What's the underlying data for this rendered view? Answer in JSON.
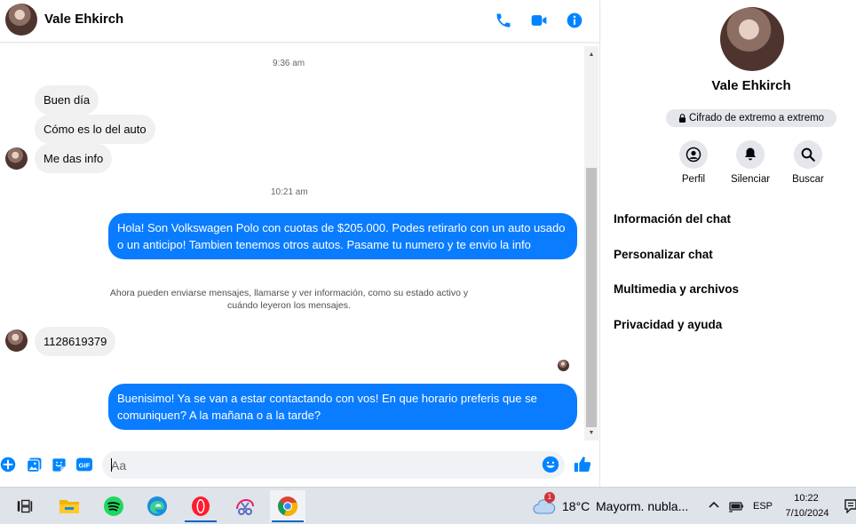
{
  "contact": {
    "name": "Vale Ehkirch"
  },
  "colors": {
    "accent": "#0084ff",
    "bubble_out": "#0a7cff",
    "bubble_in": "#f0f0f0"
  },
  "header_icons": [
    "phone-icon",
    "video-camera-icon",
    "info-icon"
  ],
  "messages": {
    "ts1": "9:36 am",
    "in1": "Buen día",
    "in2": "Cómo es lo del auto",
    "in3": "Me das info",
    "ts2": "10:21 am",
    "out1": "Hola! Son Volkswagen Polo con cuotas de $205.000. Podes retirarlo con un auto usado o un anticipo! Tambien tenemos otros autos. Pasame tu numero y te envio la info",
    "system_note": "Ahora pueden enviarse mensajes, llamarse y ver información, como su estado activo y cuándo leyeron los mensajes.",
    "in4": "1128619379",
    "out2": "Buenisimo! Ya se van a estar contactando con vos! En que horario preferis que se comuniquen? A la mañana o a la tarde?"
  },
  "composer": {
    "placeholder": "Aa",
    "value": ""
  },
  "info_panel": {
    "name": "Vale Ehkirch",
    "e2e_badge": "Cifrado de extremo a extremo",
    "actions": [
      {
        "label": "Perfil",
        "icon": "user-circle-icon"
      },
      {
        "label": "Silenciar",
        "icon": "bell-icon"
      },
      {
        "label": "Buscar",
        "icon": "search-icon"
      }
    ],
    "menu": [
      "Información del chat",
      "Personalizar chat",
      "Multimedia y archivos",
      "Privacidad y ayuda"
    ]
  },
  "taskbar": {
    "apps": [
      "task-view-icon",
      "file-explorer-icon",
      "spotify-icon",
      "edge-icon",
      "opera-icon",
      "snipping-tool-icon",
      "chrome-icon"
    ],
    "weather": {
      "temp": "18°C",
      "desc": "Mayorm. nubla...",
      "badge": "1"
    },
    "lang": "ESP",
    "time": "10:22",
    "date": "7/10/2024"
  }
}
